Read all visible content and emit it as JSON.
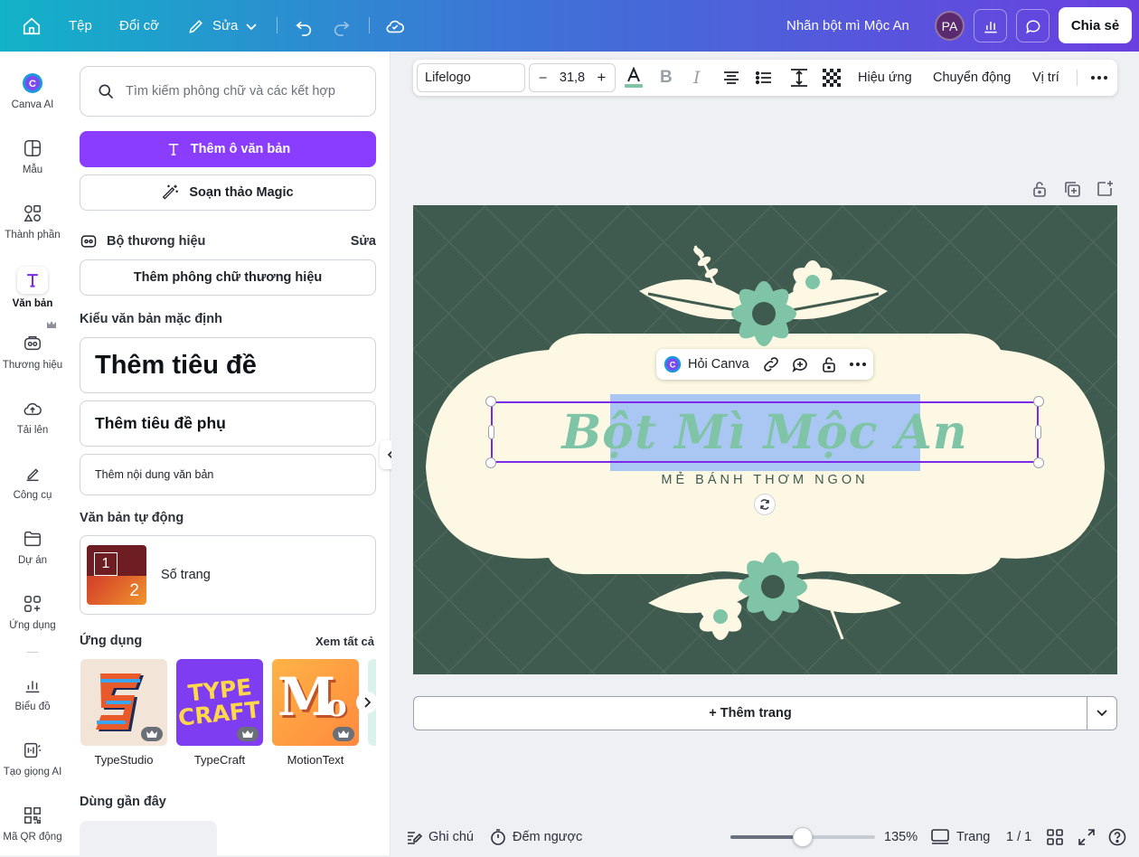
{
  "topbar": {
    "file": "Tệp",
    "resize": "Đổi cỡ",
    "edit": "Sửa",
    "doc_title": "Nhãn bột mì Mộc An",
    "avatar": "PA",
    "share": "Chia sẻ"
  },
  "rail": {
    "items": [
      {
        "label": "Canva AI",
        "icon": "canva-ai-icon"
      },
      {
        "label": "Mẫu",
        "icon": "template-icon"
      },
      {
        "label": "Thành phần",
        "icon": "elements-icon"
      },
      {
        "label": "Văn bản",
        "icon": "text-icon"
      },
      {
        "label": "Thương hiệu",
        "icon": "brand-icon"
      },
      {
        "label": "Tải lên",
        "icon": "upload-icon"
      },
      {
        "label": "Công cụ",
        "icon": "tools-icon"
      },
      {
        "label": "Dự án",
        "icon": "folder-icon"
      },
      {
        "label": "Ứng dụng",
        "icon": "apps-icon"
      },
      {
        "label": "Biểu đồ",
        "icon": "chart-icon"
      },
      {
        "label": "Tạo giọng AI",
        "icon": "ai-voice-icon"
      },
      {
        "label": "Mã QR động",
        "icon": "qr-icon"
      }
    ]
  },
  "panel": {
    "search_placeholder": "Tìm kiếm phông chữ và các kết hợp",
    "add_textbox": "Thêm ô văn bản",
    "magic_write": "Soạn thảo Magic",
    "brand_kit": "Bộ thương hiệu",
    "brand_edit": "Sửa",
    "add_brand_fonts": "Thêm phông chữ thương hiệu",
    "default_styles": "Kiểu văn bản mặc định",
    "add_heading": "Thêm tiêu đề",
    "add_subheading": "Thêm tiêu đề phụ",
    "add_body": "Thêm nội dung văn bản",
    "auto_text": "Văn bản tự động",
    "page_numbers": "Số trang",
    "thumb_num1": "1",
    "thumb_num2": "2",
    "apps": "Ứng dụng",
    "see_all": "Xem tất cả",
    "app_items": [
      "TypeStudio",
      "TypeCraft",
      "MotionText"
    ],
    "recent": "Dùng gần đây"
  },
  "toolbar": {
    "font": "Lifelogo",
    "minus": "–",
    "size": "31,8",
    "plus": "+",
    "bold": "B",
    "italic": "I",
    "effects": "Hiệu ứng",
    "animate": "Chuyển động",
    "position": "Vị trí"
  },
  "design": {
    "title": "Bột Mì Mộc An",
    "subtitle": "MẺ BÁNH THƠM NGON",
    "ask_canva": "Hỏi Canva"
  },
  "add_page": "+ Thêm trang",
  "bottom": {
    "notes": "Ghi chú",
    "timer": "Đếm ngược",
    "zoom_label": "135%",
    "zoom_level": 0.5,
    "pages": "Trang",
    "page_count": "1 / 1"
  },
  "colors": {
    "accent": "#7d2ae8",
    "design_bg": "#3f5a4f",
    "label_cream": "#fdf8e3",
    "mint": "#7fc4a6",
    "selection": "#a9c7f2"
  }
}
